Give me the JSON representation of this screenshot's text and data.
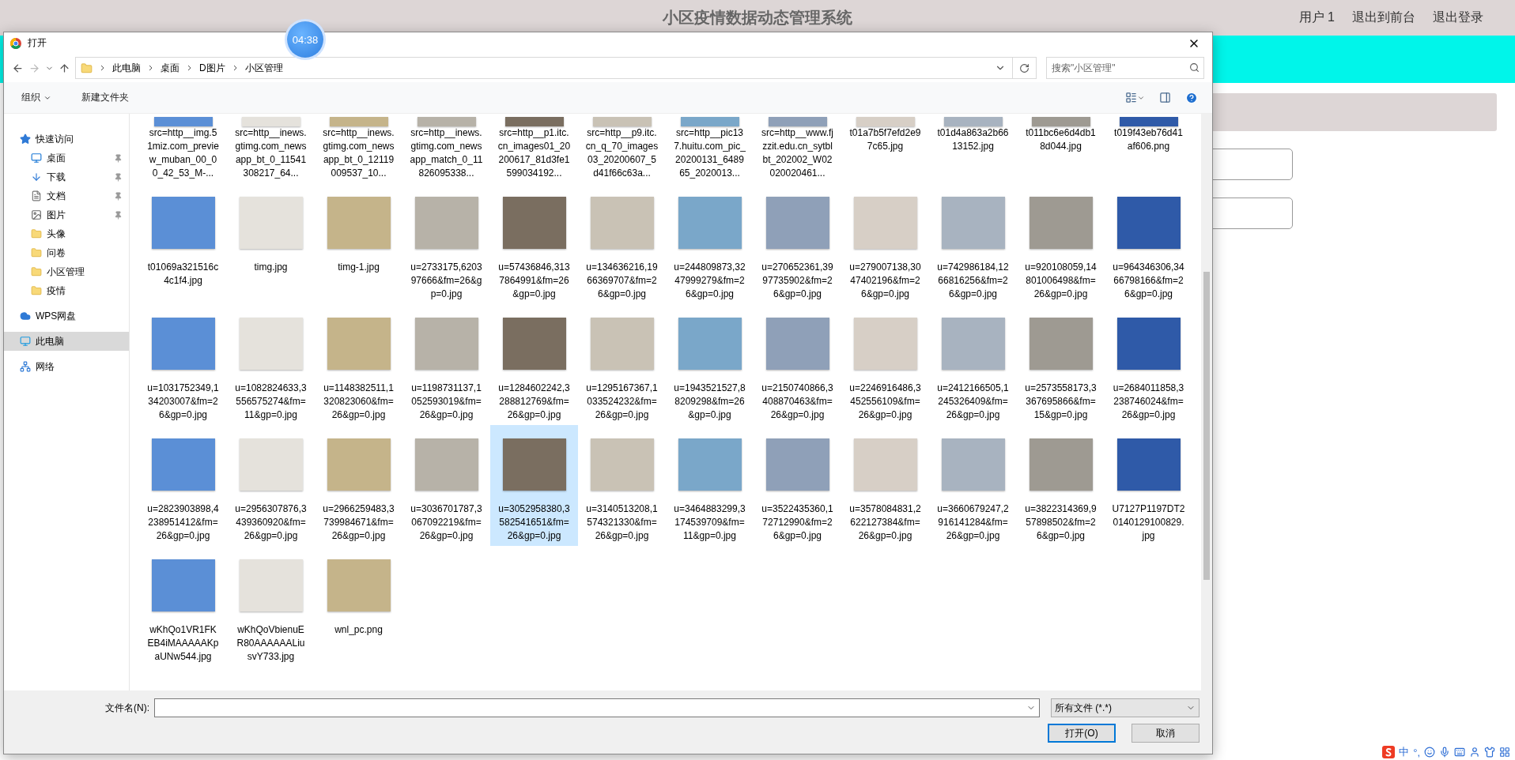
{
  "page": {
    "title": "小区疫情数据动态管理系统",
    "links": [
      "用户 1",
      "退出到前台",
      "退出登录"
    ]
  },
  "timer": "04:38",
  "dialog": {
    "title": "打开",
    "breadcrumb": [
      "此电脑",
      "桌面",
      "D图片",
      "小区管理"
    ],
    "search": {
      "placeholder": "搜索\"小区管理\""
    },
    "toolbar": [
      "组织",
      "新建文件夹"
    ],
    "sidebar": [
      {
        "label": "快速访问",
        "kind": "quick",
        "selected": false,
        "children": [
          {
            "label": "桌面",
            "kind": "desktop",
            "pinned": true,
            "selected": false
          },
          {
            "label": "下载",
            "kind": "download",
            "pinned": true,
            "selected": false
          },
          {
            "label": "文档",
            "kind": "document",
            "pinned": true,
            "selected": false
          },
          {
            "label": "图片",
            "kind": "picture",
            "pinned": true,
            "selected": false
          },
          {
            "label": "头像",
            "kind": "folder",
            "pinned": false,
            "selected": false
          },
          {
            "label": "问卷",
            "kind": "folder",
            "pinned": false,
            "selected": false
          },
          {
            "label": "小区管理",
            "kind": "folder",
            "pinned": false,
            "selected": false
          },
          {
            "label": "疫情",
            "kind": "folder",
            "pinned": false,
            "selected": false
          }
        ]
      },
      {
        "label": "WPS网盘",
        "kind": "cloud",
        "selected": false
      },
      {
        "label": "此电脑",
        "kind": "computer",
        "selected": true
      },
      {
        "label": "网络",
        "kind": "network",
        "selected": false
      }
    ],
    "files": [
      {
        "name": "src=http__img.51miz.com_preview_muban_00_00_42_53_M-...",
        "selected": false
      },
      {
        "name": "src=http__inews.gtimg.com_newsapp_bt_0_11541308217_64...",
        "selected": false
      },
      {
        "name": "src=http__inews.gtimg.com_newsapp_bt_0_12119009537_10...",
        "selected": false
      },
      {
        "name": "src=http__inews.gtimg.com_newsapp_match_0_11826095338...",
        "selected": false
      },
      {
        "name": "src=http__p1.itc.cn_images01_20200617_81d3fe1599034192...",
        "selected": false
      },
      {
        "name": "src=http__p9.itc.cn_q_70_images03_20200607_5d41f66c63a...",
        "selected": false
      },
      {
        "name": "src=http__pic137.huitu.com_pic_20200131_648965_2020013...",
        "selected": false
      },
      {
        "name": "src=http__www.fjzzit.edu.cn_sytblbt_202002_W02020020461...",
        "selected": false
      },
      {
        "name": "t01a7b5f7efd2e97c65.jpg",
        "selected": false
      },
      {
        "name": "t01d4a863a2b6613152.jpg",
        "selected": false
      },
      {
        "name": "t011bc6e6d4db18d044.jpg",
        "selected": false
      },
      {
        "name": "t019f43eb76d41af606.png",
        "selected": false
      },
      {
        "name": "t01069a321516c4c1f4.jpg",
        "selected": false
      },
      {
        "name": "timg.jpg",
        "selected": false
      },
      {
        "name": "timg-1.jpg",
        "selected": false
      },
      {
        "name": "u=2733175,620397666&fm=26&gp=0.jpg",
        "selected": false
      },
      {
        "name": "u=57436846,3137864991&fm=26&gp=0.jpg",
        "selected": false
      },
      {
        "name": "u=134636216,1966369707&fm=26&gp=0.jpg",
        "selected": false
      },
      {
        "name": "u=244809873,3247999279&fm=26&gp=0.jpg",
        "selected": false
      },
      {
        "name": "u=270652361,3997735902&fm=26&gp=0.jpg",
        "selected": false
      },
      {
        "name": "u=279007138,3047402196&fm=26&gp=0.jpg",
        "selected": false
      },
      {
        "name": "u=742986184,1266816256&fm=26&gp=0.jpg",
        "selected": false
      },
      {
        "name": "u=920108059,14801006498&fm=26&gp=0.jpg",
        "selected": false
      },
      {
        "name": "u=964346306,3466798166&fm=26&gp=0.jpg",
        "selected": false
      },
      {
        "name": "u=1031752349,134203007&fm=26&gp=0.jpg",
        "selected": false
      },
      {
        "name": "u=1082824633,3556575274&fm=11&gp=0.jpg",
        "selected": false
      },
      {
        "name": "u=1148382511,1320823060&fm=26&gp=0.jpg",
        "selected": false
      },
      {
        "name": "u=1198731137,1052593019&fm=26&gp=0.jpg",
        "selected": false
      },
      {
        "name": "u=1284602242,3288812769&fm=26&gp=0.jpg",
        "selected": false
      },
      {
        "name": "u=1295167367,1033524232&fm=26&gp=0.jpg",
        "selected": false
      },
      {
        "name": "u=1943521527,88209298&fm=26&gp=0.jpg",
        "selected": false
      },
      {
        "name": "u=2150740866,3408870463&fm=26&gp=0.jpg",
        "selected": false
      },
      {
        "name": "u=2246916486,3452556109&fm=26&gp=0.jpg",
        "selected": false
      },
      {
        "name": "u=2412166505,1245326409&fm=26&gp=0.jpg",
        "selected": false
      },
      {
        "name": "u=2573558173,3367695866&fm=15&gp=0.jpg",
        "selected": false
      },
      {
        "name": "u=2684011858,3238746024&fm=26&gp=0.jpg",
        "selected": false
      },
      {
        "name": "u=2823903898,4238951412&fm=26&gp=0.jpg",
        "selected": false
      },
      {
        "name": "u=2956307876,3439360920&fm=26&gp=0.jpg",
        "selected": false
      },
      {
        "name": "u=2966259483,3739984671&fm=26&gp=0.jpg",
        "selected": false
      },
      {
        "name": "u=3036701787,3067092219&fm=26&gp=0.jpg",
        "selected": false
      },
      {
        "name": "u=3052958380,3582541651&fm=26&gp=0.jpg",
        "selected": true
      },
      {
        "name": "u=3140513208,1574321330&fm=26&gp=0.jpg",
        "selected": false
      },
      {
        "name": "u=3464883299,3174539709&fm=11&gp=0.jpg",
        "selected": false
      },
      {
        "name": "u=3522435360,172712990&fm=26&gp=0.jpg",
        "selected": false
      },
      {
        "name": "u=3578084831,2622127384&fm=26&gp=0.jpg",
        "selected": false
      },
      {
        "name": "u=3660679247,2916141284&fm=26&gp=0.jpg",
        "selected": false
      },
      {
        "name": "u=3822314369,957898502&fm=26&gp=0.jpg",
        "selected": false
      },
      {
        "name": "U7127P1197DT20140129100829.jpg",
        "selected": false
      },
      {
        "name": "wKhQo1VR1FKEB4iMAAAAAKpaUNw544.jpg",
        "selected": false
      },
      {
        "name": "wKhQoVbienuER80AAAAAALiusvY733.jpg",
        "selected": false
      },
      {
        "name": "wnl_pc.png",
        "selected": false
      }
    ],
    "filename_label": "文件名(N):",
    "filter": "所有文件 (*.*)",
    "buttons": [
      "打开(O)",
      "取消"
    ]
  },
  "tray": {
    "ime": "中",
    "punct": "°,"
  }
}
